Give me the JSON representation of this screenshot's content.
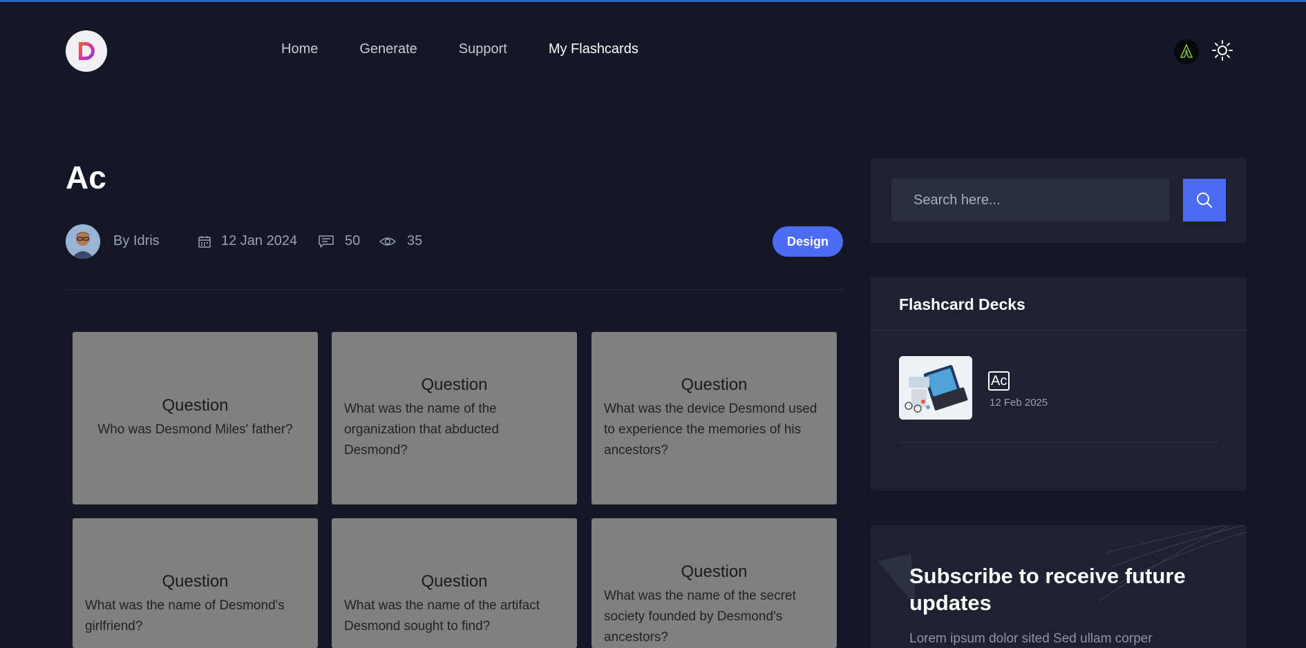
{
  "header": {
    "logo_letter": "D",
    "nav": [
      {
        "label": "Home",
        "active": false
      },
      {
        "label": "Generate",
        "active": false
      },
      {
        "label": "Support",
        "active": false
      },
      {
        "label": "My Flashcards",
        "active": true
      }
    ],
    "theme_icon": "sun-icon"
  },
  "post": {
    "title": "Ac",
    "author": "By Idris",
    "date": "12 Jan 2024",
    "comments": "50",
    "views": "35",
    "tag": "Design"
  },
  "cards": [
    {
      "label": "Question",
      "text": "Who was Desmond Miles' father?"
    },
    {
      "label": "Question",
      "text": "What was the name of the organization that abducted Desmond?"
    },
    {
      "label": "Question",
      "text": "What was the device Desmond used to experience the memories of his ancestors?"
    },
    {
      "label": "Question",
      "text": "What was the name of Desmond's girlfriend?"
    },
    {
      "label": "Question",
      "text": "What was the name of the artifact Desmond sought to find?"
    },
    {
      "label": "Question",
      "text": "What was the name of the secret society founded by Desmond's ancestors?"
    }
  ],
  "sidebar": {
    "search": {
      "placeholder": "Search here..."
    },
    "decks": {
      "title": "Flashcard Decks",
      "items": [
        {
          "name": "Ac",
          "date": "12 Feb 2025"
        }
      ]
    },
    "subscribe": {
      "title": "Subscribe to receive future updates",
      "text": "Lorem ipsum dolor sited Sed ullam corper"
    }
  },
  "colors": {
    "background": "#141826",
    "panel": "#1e2230",
    "accent": "#4a6cf7",
    "card": "#808080"
  }
}
